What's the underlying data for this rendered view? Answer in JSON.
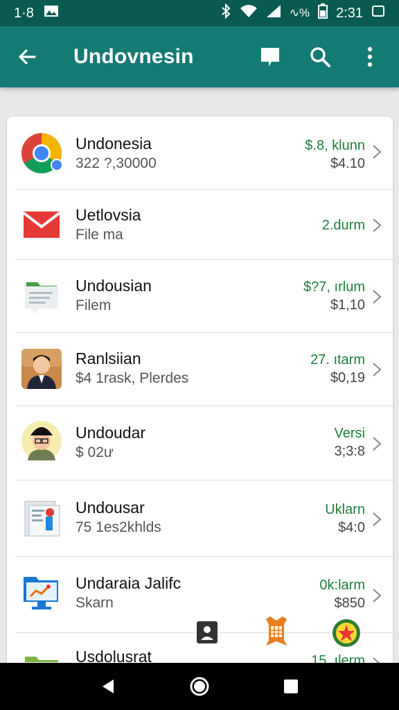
{
  "status_bar": {
    "left_text": "1·8",
    "battery_text": "∿%",
    "time": "2:31",
    "icons": [
      "image-icon",
      "bluetooth-icon",
      "wifi-icon",
      "signal-icon",
      "battery-icon",
      "screen-icon"
    ]
  },
  "app_bar": {
    "title": "Undovnesin",
    "actions": [
      "chat-icon",
      "search-icon",
      "more-vert-icon"
    ]
  },
  "list": [
    {
      "title": "Undonesia",
      "subtitle": "322 ?,30000",
      "value1": "$.8, klunn",
      "value2": "$4.10",
      "icon": "chrome-icon"
    },
    {
      "title": "Uetlovsia",
      "subtitle": "File ma",
      "value1": "2.durm",
      "value2": "",
      "icon": "gmail-icon"
    },
    {
      "title": "Undousian",
      "subtitle": "Filem",
      "value1": "$?7, ırlum",
      "value2": "$1,10",
      "icon": "files-icon"
    },
    {
      "title": "Ranlsiian",
      "subtitle": "$4 1rask, Plerdes",
      "value1": "27. ıtarm",
      "value2": "$0,19",
      "icon": "person-photo-icon"
    },
    {
      "title": "Undoudar",
      "subtitle": "$ 02ư",
      "value1": "Versi",
      "value2": "3;3:8",
      "icon": "person-cap-icon"
    },
    {
      "title": "Undousar",
      "subtitle": "75 1es2khlds",
      "value1": "Uklarn",
      "value2": "$4:0",
      "icon": "document-icon"
    },
    {
      "title": "Undaraia Jalifc",
      "subtitle": "Skarn",
      "value1": "0k:larm",
      "value2": "$850",
      "icon": "monitor-icon"
    },
    {
      "title": "Usdolusrat",
      "subtitle": "",
      "value1": "15. ılerm",
      "value2": "",
      "icon": "folder-icon"
    }
  ],
  "nav_bar": [
    "back-nav-icon",
    "home-nav-icon",
    "recents-nav-icon"
  ],
  "colors": {
    "app_bar": "#137b74",
    "status_bar": "#0b5a52",
    "value_green": "#1e7d3c"
  }
}
